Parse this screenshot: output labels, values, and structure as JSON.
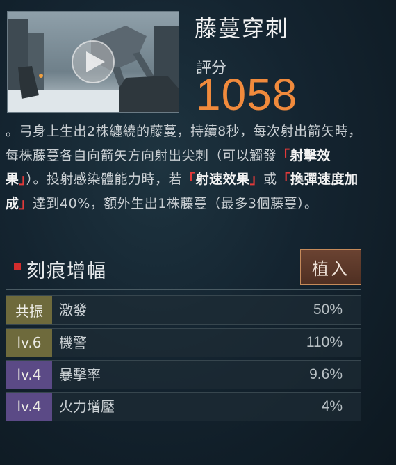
{
  "skill": {
    "title": "藤蔓穿刺",
    "score_label": "評分",
    "score_value": "1058",
    "video_thumbnail": "play-icon"
  },
  "description": {
    "p1": "。弓身上生出2株纏繞的藤蔓，持續8秒，每次射出箭矢時，每株藤蔓各自向箭矢方向射出尖刺（可以觸發",
    "q1_open": "「",
    "kw1": "射擊效果",
    "q1_close": "」",
    "p2": "）。投射感染體能力時，若",
    "q2_open": "「",
    "kw2": "射速效果",
    "q2_close": "」",
    "p3": "或",
    "q3_open": "「",
    "kw3": "換彈速度加成",
    "q3_close": "」",
    "p4": "達到40%，額外生出1株藤蔓（最多3個藤蔓）。"
  },
  "imprint": {
    "title": "刻痕增幅",
    "equip_button": "植入",
    "rows": [
      {
        "badge": "共振",
        "badge_color": "#6e6a3c",
        "name": "激發",
        "value": "50%"
      },
      {
        "badge": "lv.6",
        "badge_color": "#6e6a3c",
        "name": "機警",
        "value": "110%"
      },
      {
        "badge": "lv.4",
        "badge_color": "#5b4a86",
        "name": "暴擊率",
        "value": "9.6%"
      },
      {
        "badge": "lv.4",
        "badge_color": "#5b4a86",
        "name": "火力增壓",
        "value": "4%"
      }
    ]
  }
}
